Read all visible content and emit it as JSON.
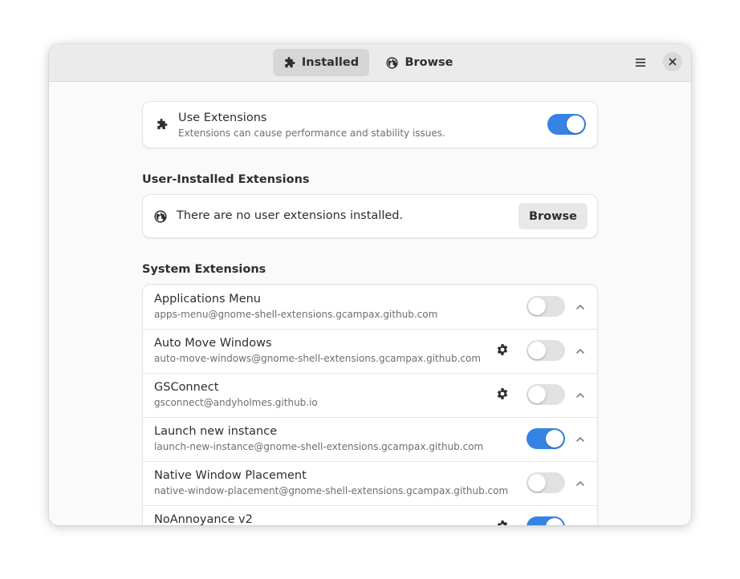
{
  "header": {
    "tabs": [
      {
        "label": "Installed",
        "icon": "puzzle-icon",
        "active": true
      },
      {
        "label": "Browse",
        "icon": "globe-icon",
        "active": false
      }
    ],
    "menu_icon": "hamburger-menu-icon",
    "close_icon": "close-icon"
  },
  "use_extensions": {
    "title": "Use Extensions",
    "subtitle": "Extensions can cause performance and stability issues.",
    "enabled": true
  },
  "user_section": {
    "title": "User-Installed Extensions",
    "empty_text": "There are no user extensions installed.",
    "browse_label": "Browse"
  },
  "system_section": {
    "title": "System Extensions",
    "items": [
      {
        "name": "Applications Menu",
        "uuid": "apps-menu@gnome-shell-extensions.gcampax.github.com",
        "has_settings": false,
        "enabled": false
      },
      {
        "name": "Auto Move Windows",
        "uuid": "auto-move-windows@gnome-shell-extensions.gcampax.github.com",
        "has_settings": true,
        "enabled": false
      },
      {
        "name": "GSConnect",
        "uuid": "gsconnect@andyholmes.github.io",
        "has_settings": true,
        "enabled": false
      },
      {
        "name": "Launch new instance",
        "uuid": "launch-new-instance@gnome-shell-extensions.gcampax.github.com",
        "has_settings": false,
        "enabled": true
      },
      {
        "name": "Native Window Placement",
        "uuid": "native-window-placement@gnome-shell-extensions.gcampax.github.com",
        "has_settings": false,
        "enabled": false
      },
      {
        "name": "NoAnnoyance v2",
        "uuid": "",
        "has_settings": true,
        "enabled": true
      }
    ]
  },
  "colors": {
    "accent": "#3584e4",
    "switch_off": "#e1e1e1"
  }
}
